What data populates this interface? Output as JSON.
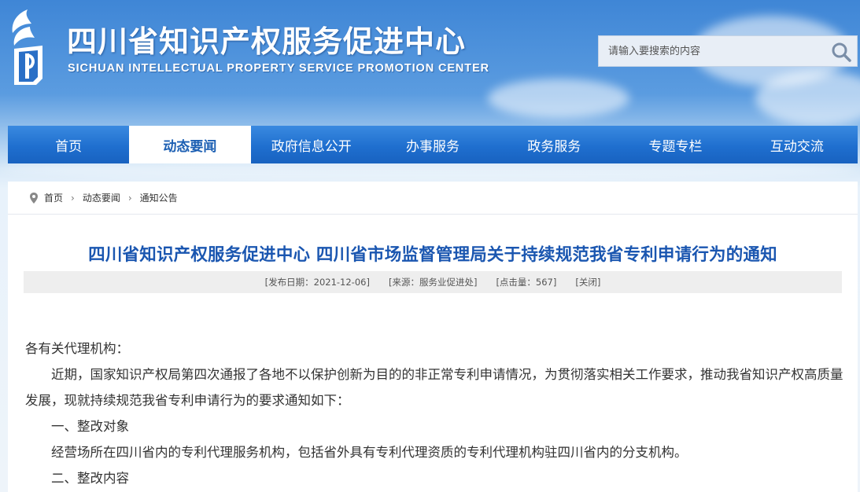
{
  "header": {
    "title": "四川省知识产权服务促进中心",
    "subtitle": "SICHUAN INTELLECTUAL PROPERTY SERVICE PROMOTION CENTER",
    "logo_icon": "sichuan-ip-logo"
  },
  "search": {
    "placeholder": "请输入要搜索的内容",
    "icon": "search-icon"
  },
  "nav": {
    "items": [
      {
        "label": "首页"
      },
      {
        "label": "动态要闻"
      },
      {
        "label": "政府信息公开"
      },
      {
        "label": "办事服务"
      },
      {
        "label": "政务服务"
      },
      {
        "label": "专题专栏"
      },
      {
        "label": "互动交流"
      }
    ],
    "active_index": 1
  },
  "breadcrumb": {
    "icon": "location-pin-icon",
    "items": [
      "首页",
      "动态要闻",
      "通知公告"
    ]
  },
  "article": {
    "title": "四川省知识产权服务促进中心 四川省市场监督管理局关于持续规范我省专利申请行为的通知",
    "meta": {
      "date": "[发布日期：2021-12-06]",
      "source": "[来源：服务业促进处]",
      "clicks": "[点击量：567]",
      "close": "[关闭]"
    },
    "paragraphs": [
      "各有关代理机构：",
      "近期，国家知识产权局第四次通报了各地不以保护创新为目的的非正常专利申请情况，为贯彻落实相关工作要求，推动我省知识产权高质量发展，现就持续规范我省专利申请行为的要求通知如下：",
      "一、整改对象",
      "经营场所在四川省内的专利代理服务机构，包括省外具有专利代理资质的专利代理机构驻四川省内的分支机构。",
      "二、整改内容"
    ]
  },
  "colors": {
    "nav_blue": "#1f6fcf",
    "title_blue": "#1a56b0",
    "active_tab_bg": "#ffffff"
  }
}
